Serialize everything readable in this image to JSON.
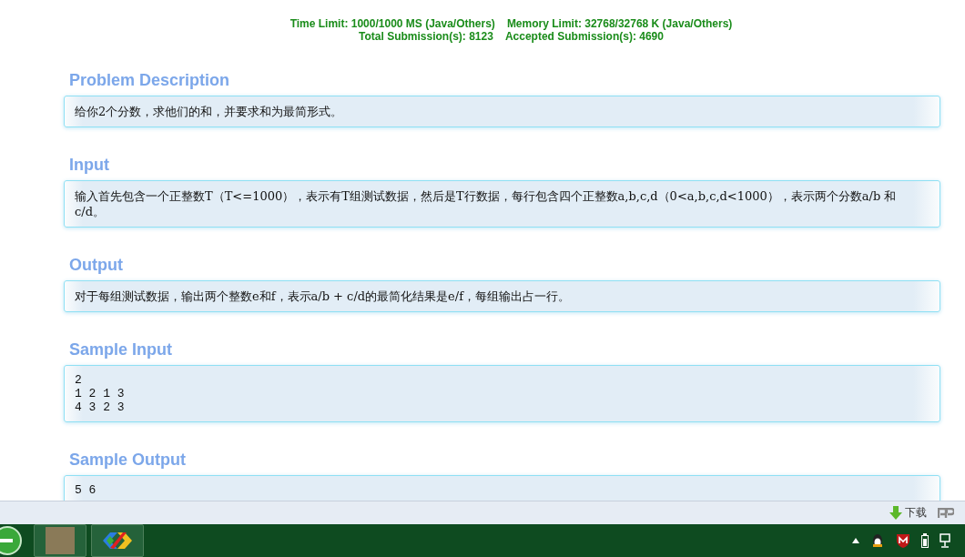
{
  "limits": {
    "line_1": [
      "Time Limit: 1000/1000 MS (Java/Others)",
      "Memory Limit: 32768/32768 K (Java/Others)"
    ],
    "line_2": [
      "Total Submission(s): 8123",
      "Accepted Submission(s): 4690"
    ]
  },
  "sections": [
    {
      "title": "Problem Description",
      "kind": "text",
      "body": "给你2个分数，求他们的和，并要求和为最简形式。"
    },
    {
      "title": "Input",
      "kind": "text",
      "body": "输入首先包含一个正整数T（T<=1000），表示有T组测试数据，然后是T行数据，每行包含四个正整数a,b,c,d（0<a,b,c,d<1000），表示两个分数a/b 和 c/d。"
    },
    {
      "title": "Output",
      "kind": "text",
      "body": "对于每组测试数据，输出两个整数e和f，表示a/b + c/d的最简化结果是e/f，每组输出占一行。"
    },
    {
      "title": "Sample Input",
      "kind": "code",
      "body": "2\n1 2 1 3\n4 3 2 3"
    },
    {
      "title": "Sample Output",
      "kind": "code",
      "body": "5 6"
    }
  ],
  "status_bar": {
    "download": "下载"
  }
}
